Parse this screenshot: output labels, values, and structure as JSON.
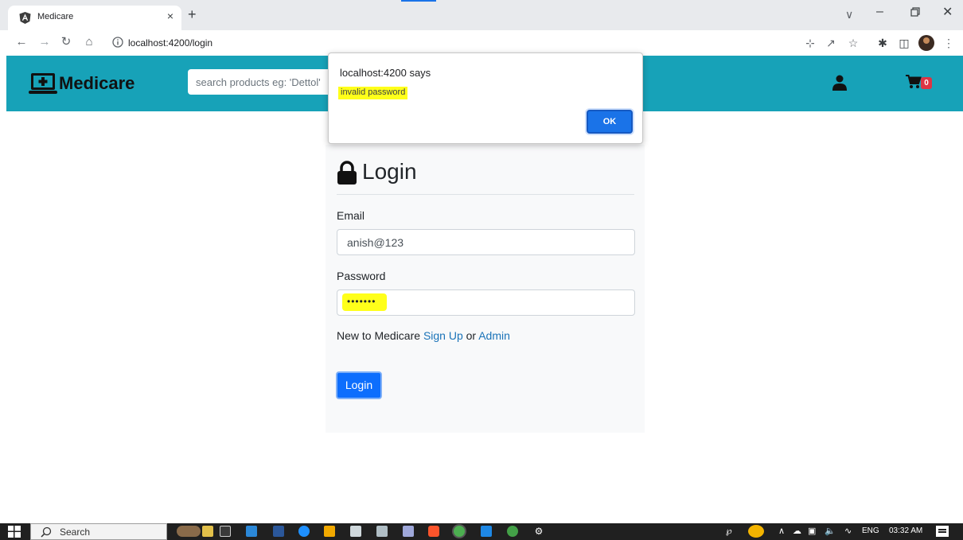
{
  "browser": {
    "tab_title": "Medicare",
    "close_tab_glyph": "×",
    "new_tab_glyph": "+",
    "url": "localhost:4200/login",
    "icons": [
      "angular-favicon",
      "back-icon",
      "forward-icon",
      "reload-icon",
      "home-icon",
      "site-info-icon",
      "key-icon",
      "share-icon",
      "bookmark-star-icon",
      "extensions-icon",
      "side-panel-icon",
      "profile-avatar",
      "menu-kebab-icon"
    ]
  },
  "app_header": {
    "brand_name": "Medicare",
    "search_placeholder": "search products eg: 'Dettol'",
    "cart_count": "0",
    "background_color": "#17a2b8"
  },
  "alert": {
    "title": "localhost:4200 says",
    "message": "invalid password",
    "ok_label": "OK",
    "highlight_color": "#ffff1a"
  },
  "login": {
    "title": "Login",
    "email_label": "Email",
    "email_value": "anish@123",
    "password_label": "Password",
    "password_value": "•••••••",
    "new_to_text": "New to Medicare",
    "signup_link": "Sign Up",
    "or_text": "or",
    "admin_link": "Admin",
    "button_label": "Login"
  },
  "taskbar": {
    "search_label": "Search",
    "language": "ENG",
    "time": "03:32 AM"
  }
}
